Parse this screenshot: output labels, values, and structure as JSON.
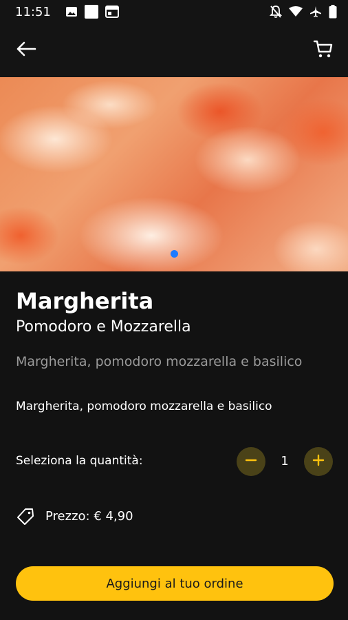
{
  "status_bar": {
    "time": "11:51",
    "icons": [
      "image-icon",
      "square-icon",
      "calendar-icon",
      "notifications-off-icon",
      "wifi-icon",
      "airplane-icon",
      "battery-icon"
    ]
  },
  "app_bar": {
    "back_icon": "arrow-left-icon",
    "cart_icon": "cart-icon"
  },
  "hero": {
    "image": "pizza-margherita-photo",
    "carousel_index": 1
  },
  "product": {
    "name": "Margherita",
    "subtitle": "Pomodoro e Mozzarella",
    "description_gray": "Margherita, pomodoro mozzarella e basilico",
    "description_white": "Margherita, pomodoro mozzarella e basilico"
  },
  "quantity": {
    "label": "Seleziona la quantità:",
    "value": "1",
    "minus_symbol": "−",
    "plus_symbol": "+"
  },
  "price": {
    "icon": "tag-icon",
    "text": "Prezzo: € 4,90"
  },
  "cta": {
    "label": "Aggiungi al tuo ordine"
  },
  "colors": {
    "accent": "#ffc20e",
    "background": "#121212",
    "qty_button_bg": "#4a4218",
    "carousel_dot": "#1e7bff"
  }
}
